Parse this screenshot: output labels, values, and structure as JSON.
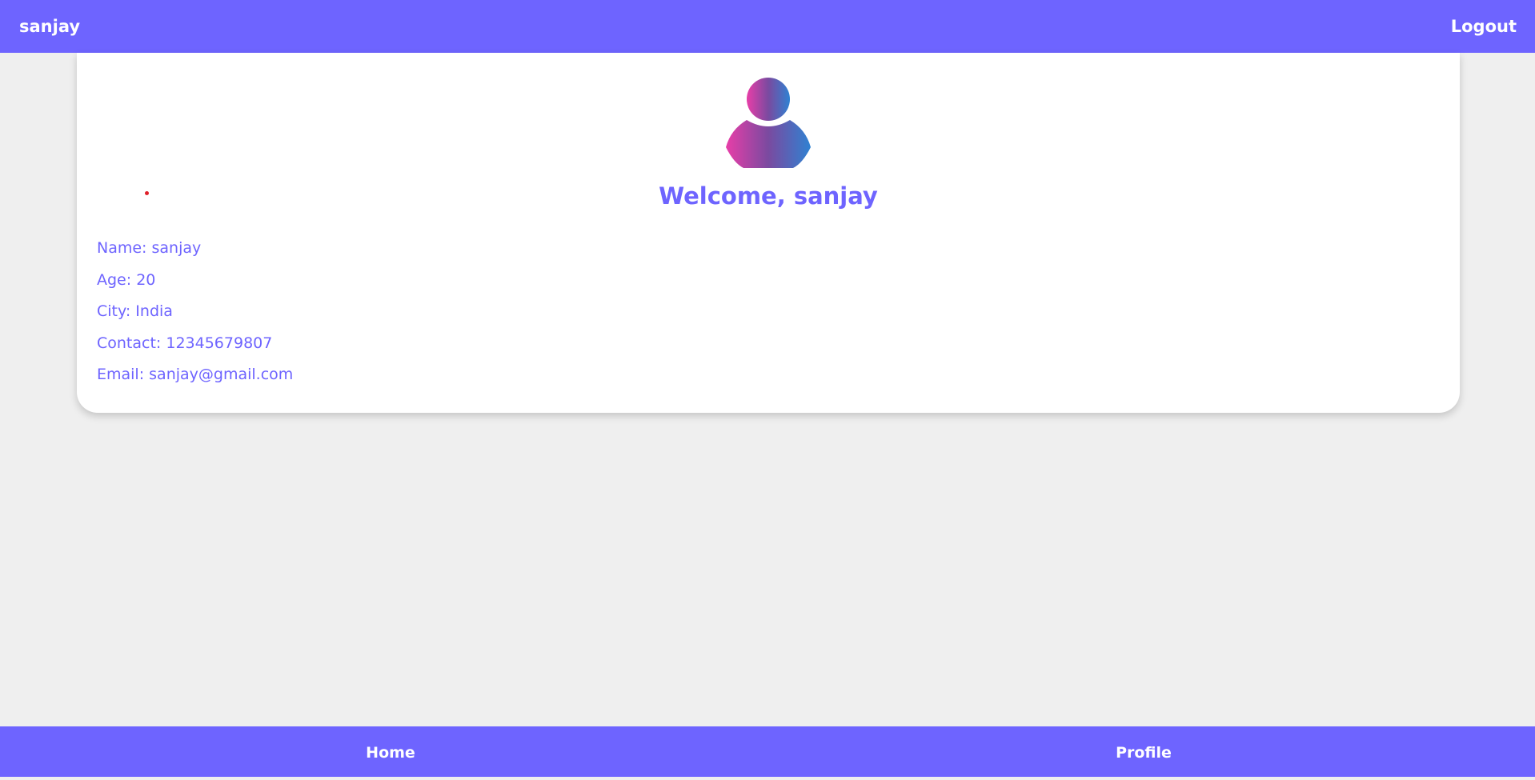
{
  "header": {
    "brand": "sanjay",
    "logout_label": "Logout"
  },
  "profile": {
    "avatar_icon": "user-avatar-icon",
    "welcome": "Welcome, sanjay",
    "fields": [
      "Name: sanjay",
      "Age: 20",
      "City: India",
      "Contact: 12345679807",
      "Email: sanjay@gmail.com"
    ]
  },
  "footer": {
    "nav": [
      "Home",
      "Profile"
    ]
  },
  "colors": {
    "accent": "#6e64ff",
    "background": "#efefef",
    "card": "#ffffff",
    "avatar_gradient": [
      "#e83ea8",
      "#7a4aa0",
      "#2f82d2"
    ]
  }
}
